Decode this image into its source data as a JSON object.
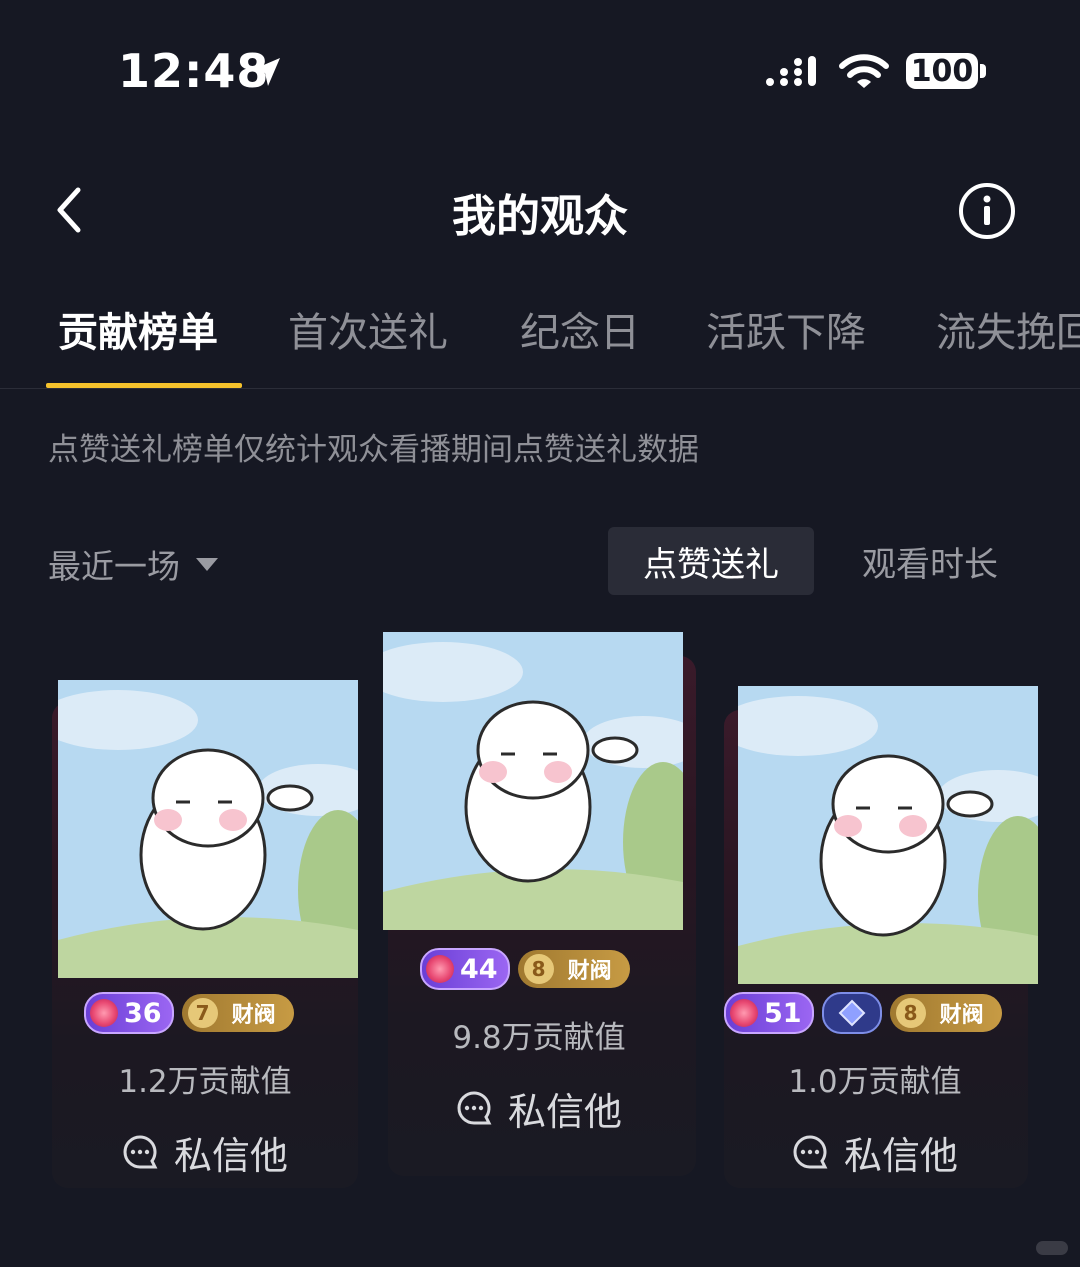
{
  "status_bar": {
    "time": "12:48",
    "battery": "100"
  },
  "header": {
    "title": "我的观众"
  },
  "tabs": [
    {
      "label": "贡献榜单",
      "active": true
    },
    {
      "label": "首次送礼"
    },
    {
      "label": "纪念日"
    },
    {
      "label": "活跃下降"
    },
    {
      "label": "流失挽回"
    }
  ],
  "notice": "点赞送礼榜单仅统计观众看播期间点赞送礼数据",
  "filters": {
    "period": "最近一场",
    "seg_like": "点赞送礼",
    "seg_watch": "观看时长",
    "selected": "点赞送礼"
  },
  "ranking": [
    {
      "rank": 1,
      "level": "44",
      "fan_level": "8",
      "fan_label": "财阀",
      "score": "9.8万贡献值",
      "dm": "私信他"
    },
    {
      "rank": 2,
      "level": "36",
      "fan_level": "7",
      "fan_label": "财阀",
      "score": "1.2万贡献值",
      "dm": "私信他"
    },
    {
      "rank": 3,
      "level": "51",
      "fan_level": "8",
      "fan_label": "财阀",
      "score": "1.0万贡献值",
      "dm": "私信他"
    }
  ],
  "colors": {
    "background": "#161823",
    "accent": "#f5c22c"
  }
}
